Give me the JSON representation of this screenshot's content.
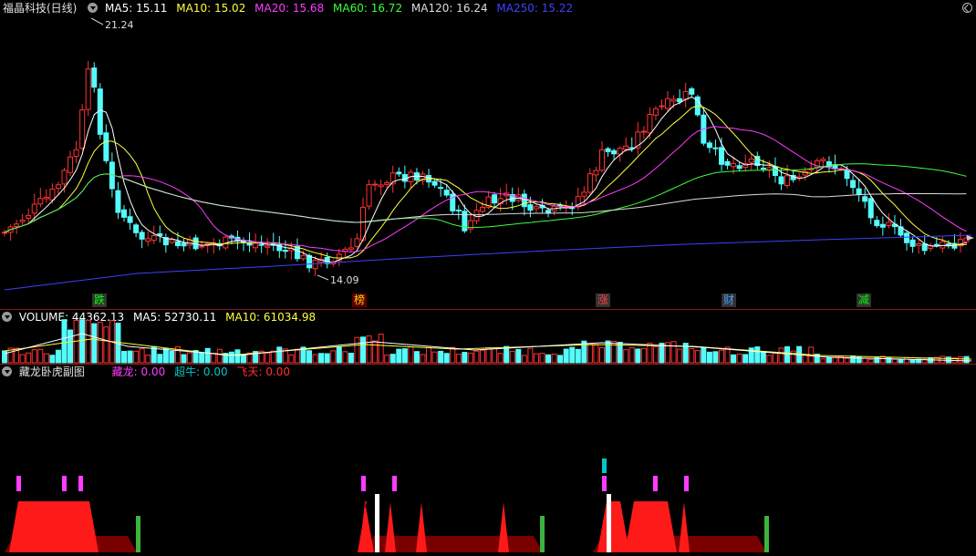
{
  "stock": {
    "title": "福晶科技(日线)",
    "ma": [
      {
        "label": "MA5: 15.11",
        "color": "#ffffff"
      },
      {
        "label": "MA10: 15.02",
        "color": "#ffff3c"
      },
      {
        "label": "MA20: 15.68",
        "color": "#ff3cff"
      },
      {
        "label": "MA60: 16.72",
        "color": "#3cff3c"
      },
      {
        "label": "MA120: 16.24",
        "color": "#dcdcdc"
      },
      {
        "label": "MA250: 15.22",
        "color": "#4040ff"
      }
    ],
    "high_label": "21.24",
    "low_label": "14.09"
  },
  "events": [
    {
      "text": "跌",
      "color": "#00ff00",
      "bg": "#333"
    },
    {
      "text": "榜",
      "color": "#ffcc00",
      "bg": "#660000"
    },
    {
      "text": "涨",
      "color": "#ff4040",
      "bg": "#333"
    },
    {
      "text": "财",
      "color": "#40a0ff",
      "bg": "#333"
    },
    {
      "text": "减",
      "color": "#00ff00",
      "bg": "#333"
    }
  ],
  "volume": {
    "label": "VOLUME: 44362.13",
    "ma5": "MA5: 52730.11",
    "ma10": "MA10: 61034.98",
    "colors": {
      "label": "#ffffff",
      "ma5": "#ffffff",
      "ma10": "#ffff3c"
    }
  },
  "indicator": {
    "title": "藏龙卧虎副图",
    "items": [
      {
        "label": "藏龙: 0.00",
        "color": "#ff3cff"
      },
      {
        "label": "超牛: 0.00",
        "color": "#00c8c8"
      },
      {
        "label": "飞天: 0.00",
        "color": "#ff3030"
      }
    ]
  },
  "colors": {
    "up": "#ff3232",
    "down": "#54fcfc",
    "bg": "#000000",
    "grid": "#8c1a1a"
  },
  "chart_data": {
    "type": "candlestick",
    "series_note": "",
    "ohlc": []
  }
}
